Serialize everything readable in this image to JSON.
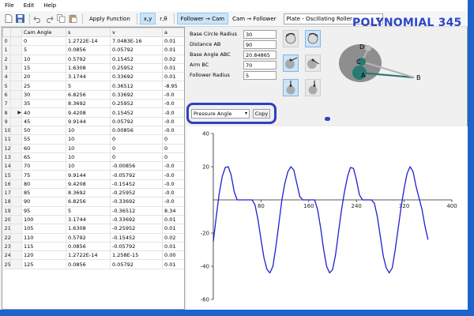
{
  "menu": [
    "File",
    "Edit",
    "Help"
  ],
  "toolbar": {
    "apply_function": "Apply Function",
    "xy": "x,y",
    "rtheta": "r,θ",
    "follower_to_cam": "Follower → Cam",
    "cam_to_follower": "Cam → Follower",
    "profile_select": "Plate - Oscillating Roller",
    "icons": [
      "new-file-icon",
      "save-icon",
      "undo-icon",
      "redo-icon",
      "copy-icon",
      "paste-icon"
    ]
  },
  "title": "POLYNOMIAL 345",
  "grid": {
    "columns": [
      "",
      "Cam Angle",
      "s",
      "v",
      "a"
    ],
    "current_row_marker": "▶",
    "rows": [
      [
        "0",
        "0",
        "1.2722E-14",
        "7.0483E-16",
        "0.01"
      ],
      [
        "1",
        "5",
        "0.0856",
        "0.05792",
        "0.01"
      ],
      [
        "2",
        "10",
        "0.5792",
        "0.15452",
        "0.02"
      ],
      [
        "3",
        "15",
        "1.6308",
        "0.25952",
        "0.01"
      ],
      [
        "4",
        "20",
        "3.1744",
        "0.33692",
        "0.01"
      ],
      [
        "5",
        "25",
        "5",
        "0.36512",
        "-8.95"
      ],
      [
        "6",
        "30",
        "6.8256",
        "0.33692",
        "-0.0"
      ],
      [
        "7",
        "35",
        "8.3692",
        "0.25952",
        "-0.0"
      ],
      [
        "8",
        "40",
        "9.4208",
        "0.15452",
        "-0.0"
      ],
      [
        "9",
        "45",
        "9.9144",
        "0.05792",
        "-0.0"
      ],
      [
        "10",
        "50",
        "10",
        "0.00856",
        "-0.0"
      ],
      [
        "11",
        "55",
        "10",
        "0",
        "0"
      ],
      [
        "12",
        "60",
        "10",
        "0",
        "0"
      ],
      [
        "13",
        "65",
        "10",
        "0",
        "0"
      ],
      [
        "14",
        "70",
        "10",
        "-0.00856",
        "-0.0"
      ],
      [
        "15",
        "75",
        "9.9144",
        "-0.05792",
        "-0.0"
      ],
      [
        "16",
        "80",
        "9.4208",
        "-0.15452",
        "-0.0"
      ],
      [
        "17",
        "85",
        "8.3692",
        "-0.25952",
        "-0.0"
      ],
      [
        "18",
        "90",
        "6.8256",
        "-0.33692",
        "-0.0"
      ],
      [
        "19",
        "95",
        "5",
        "-0.36512",
        "8.34"
      ],
      [
        "20",
        "100",
        "3.1744",
        "-0.33692",
        "0.01"
      ],
      [
        "21",
        "105",
        "1.6308",
        "-0.25952",
        "0.01"
      ],
      [
        "22",
        "110",
        "0.5792",
        "-0.15452",
        "0.02"
      ],
      [
        "23",
        "115",
        "0.0856",
        "-0.05792",
        "0.01"
      ],
      [
        "24",
        "120",
        "1.2722E-14",
        "1.258E-15",
        "0.00"
      ],
      [
        "25",
        "125",
        "0.0856",
        "0.05792",
        "0.01"
      ]
    ]
  },
  "params": [
    {
      "label": "Base Circle Radius",
      "value": "30"
    },
    {
      "label": "Distance AB",
      "value": "90"
    },
    {
      "label": "Base Angle ABC",
      "value": "20.84865"
    },
    {
      "label": "Arm BC",
      "value": "70"
    },
    {
      "label": "Follower Radius",
      "value": "5"
    }
  ],
  "pressure": {
    "select_value": "Pressure Angle",
    "copy_label": "Copy"
  },
  "linkage_labels": {
    "a": "A",
    "b": "B",
    "c": "C",
    "d": "D"
  },
  "colors": {
    "accent": "#2e46c8",
    "highlight_box": "#3040c0",
    "curve": "#1f1fd0",
    "linkage_arm": "#2a7a74",
    "cam_body": "#8e8e8e"
  },
  "chart_data": {
    "type": "line",
    "title": "",
    "xlabel": "",
    "ylabel": "",
    "xlim": [
      0,
      400
    ],
    "ylim": [
      -60,
      40
    ],
    "xticks": [
      80,
      160,
      240,
      320,
      400
    ],
    "yticks": [
      -60,
      -40,
      -20,
      20,
      40
    ],
    "xtick_labels": [
      "80",
      "160",
      "240",
      "320",
      "400"
    ],
    "ytick_labels": [
      "-60",
      "-40",
      "-20",
      "20",
      "40"
    ],
    "grid": false,
    "series": [
      {
        "x": [
          0,
          5,
          10,
          15,
          20,
          25,
          30,
          35,
          40,
          45,
          50,
          55,
          60,
          65,
          70,
          75,
          80,
          85,
          90,
          95,
          100,
          105,
          110,
          115,
          120,
          125,
          130,
          135,
          140,
          145,
          150,
          155,
          160,
          165,
          170,
          175,
          180,
          185,
          190,
          195,
          200,
          205,
          210,
          215,
          220,
          225,
          230,
          235,
          240,
          245,
          250,
          255,
          260,
          265,
          270,
          275,
          280,
          285,
          290,
          295,
          300,
          305,
          310,
          315,
          320,
          325,
          330,
          335,
          340,
          345,
          350,
          355,
          360
        ],
        "y": [
          -25,
          -10,
          4,
          14,
          19.5,
          20,
          15,
          5,
          0,
          0,
          0,
          0,
          0,
          0,
          -3,
          -12,
          -24,
          -35,
          -42,
          -44,
          -40,
          -28,
          -14,
          0,
          10,
          17,
          20,
          18,
          10,
          2,
          0,
          0,
          0,
          0,
          0,
          -6,
          -17,
          -30,
          -40,
          -44,
          -42,
          -33,
          -19,
          -6,
          5,
          14,
          19.5,
          19,
          12,
          3,
          0,
          0,
          0,
          0,
          -2,
          -10,
          -22,
          -34,
          -41,
          -44,
          -41,
          -30,
          -17,
          -4,
          7,
          16,
          20,
          17,
          8,
          1,
          -6,
          -16,
          -24
        ]
      }
    ]
  }
}
